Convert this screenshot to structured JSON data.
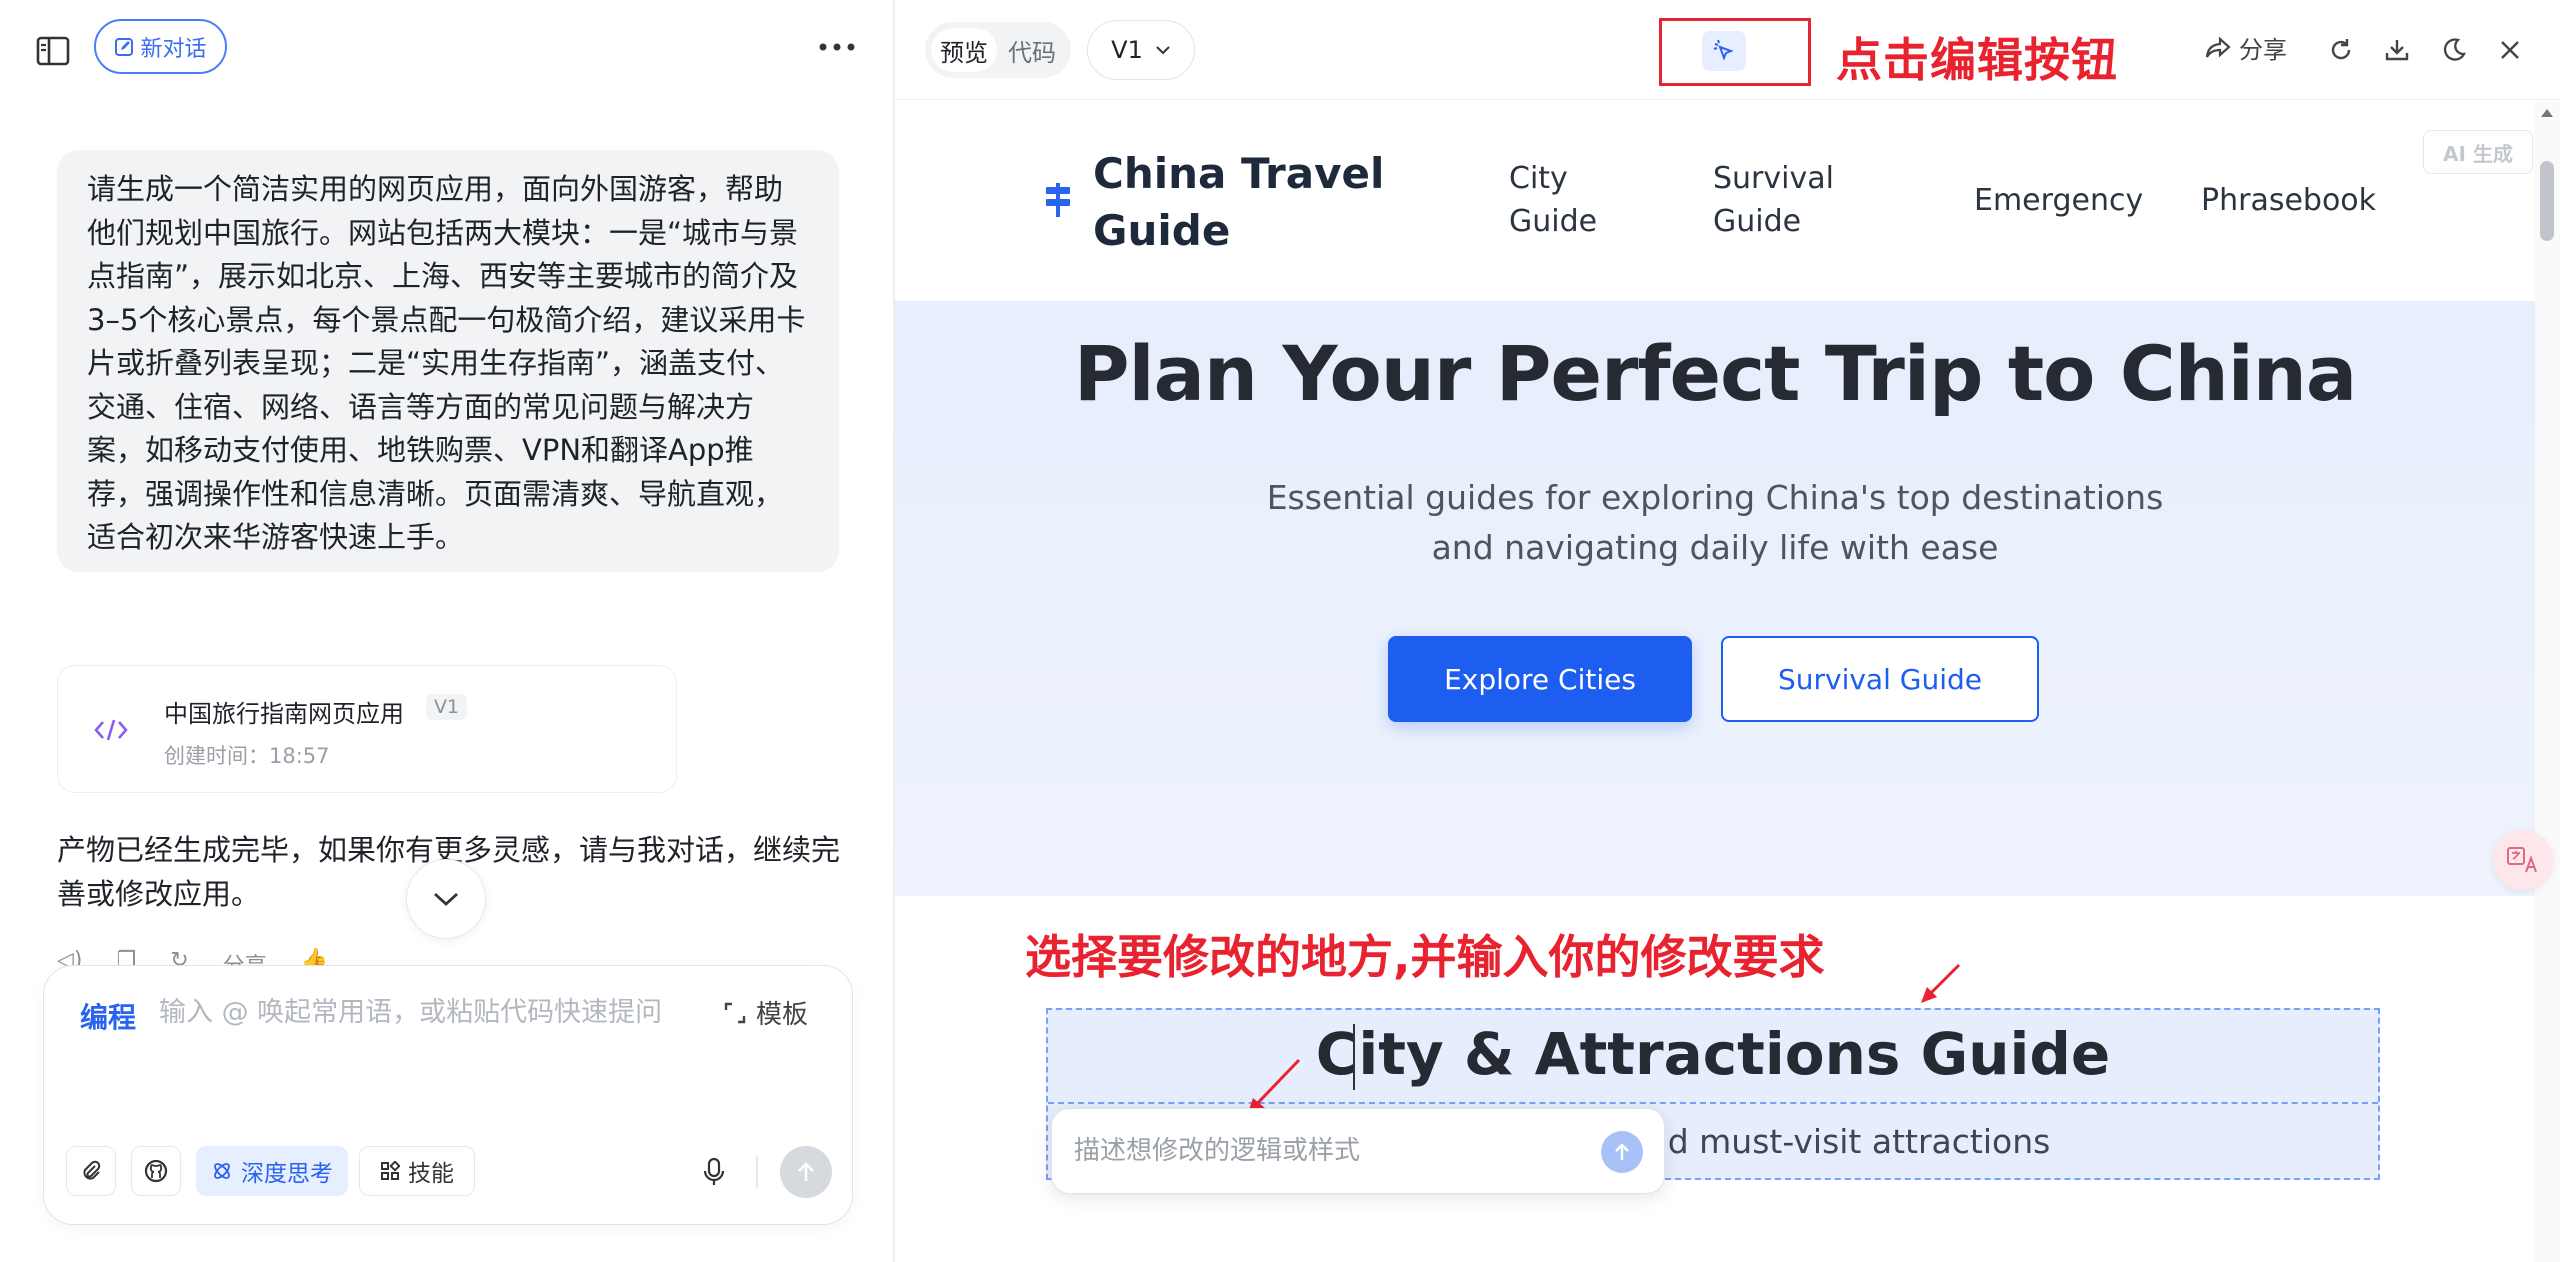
{
  "left": {
    "new_chat_label": "新对话",
    "user_message": "请生成一个简洁实用的网页应用，面向外国游客，帮助他们规划中国旅行。网站包括两大模块：一是“城市与景点指南”，展示如北京、上海、西安等主要城市的简介及3–5个核心景点，每个景点配一句极简介绍，建议采用卡片或折叠列表呈现；二是“实用生存指南”，涵盖支付、交通、住宿、网络、语言等方面的常见问题与解决方案，如移动支付使用、地铁购票、VPN和翻译App推荐，强调操作性和信息清晰。页面需清爽、导航直观，适合初次来华游客快速上手。",
    "artifact": {
      "title": "中国旅行指南网页应用",
      "version": "V1",
      "created": "创建时间：18:57"
    },
    "bot_message": "产物已经生成完毕，如果你有更多灵感，请与我对话，继续完善或修改应用。",
    "actions": [
      "分享"
    ],
    "composer": {
      "mode": "编程",
      "placeholder": "输入 @ 唤起常用语，或粘贴代码快速提问",
      "template_label": "模板",
      "deep_think_label": "深度思考",
      "skills_label": "技能"
    }
  },
  "right": {
    "tabs": [
      {
        "label": "预览",
        "active": true
      },
      {
        "label": "代码",
        "active": false
      }
    ],
    "version": "V1",
    "annotation_edit": "点击编辑按钮",
    "share_label": "分享",
    "preview": {
      "site_name": "China Travel Guide",
      "nav": [
        "City Guide",
        "Survival Guide",
        "Emergency",
        "Phrasebook"
      ],
      "ai_badge": "AI 生成",
      "hero_title": "Plan Your Perfect Trip to China",
      "hero_subtitle": "Essential guides for exploring China's top destinations and navigating daily life with ease",
      "btn_primary": "Explore Cities",
      "btn_secondary": "Survival Guide",
      "annotation_select": "选择要修改的地方,并输入你的修改要求",
      "section_title": "City & Attractions Guide",
      "section_subtitle": "tions and must-visit attractions",
      "edit_placeholder": "描述想修改的逻辑或样式"
    }
  },
  "colors": {
    "accent": "#1d5ef1",
    "annotation_red": "#e8222e",
    "hero_bg": "#e7eefc"
  }
}
